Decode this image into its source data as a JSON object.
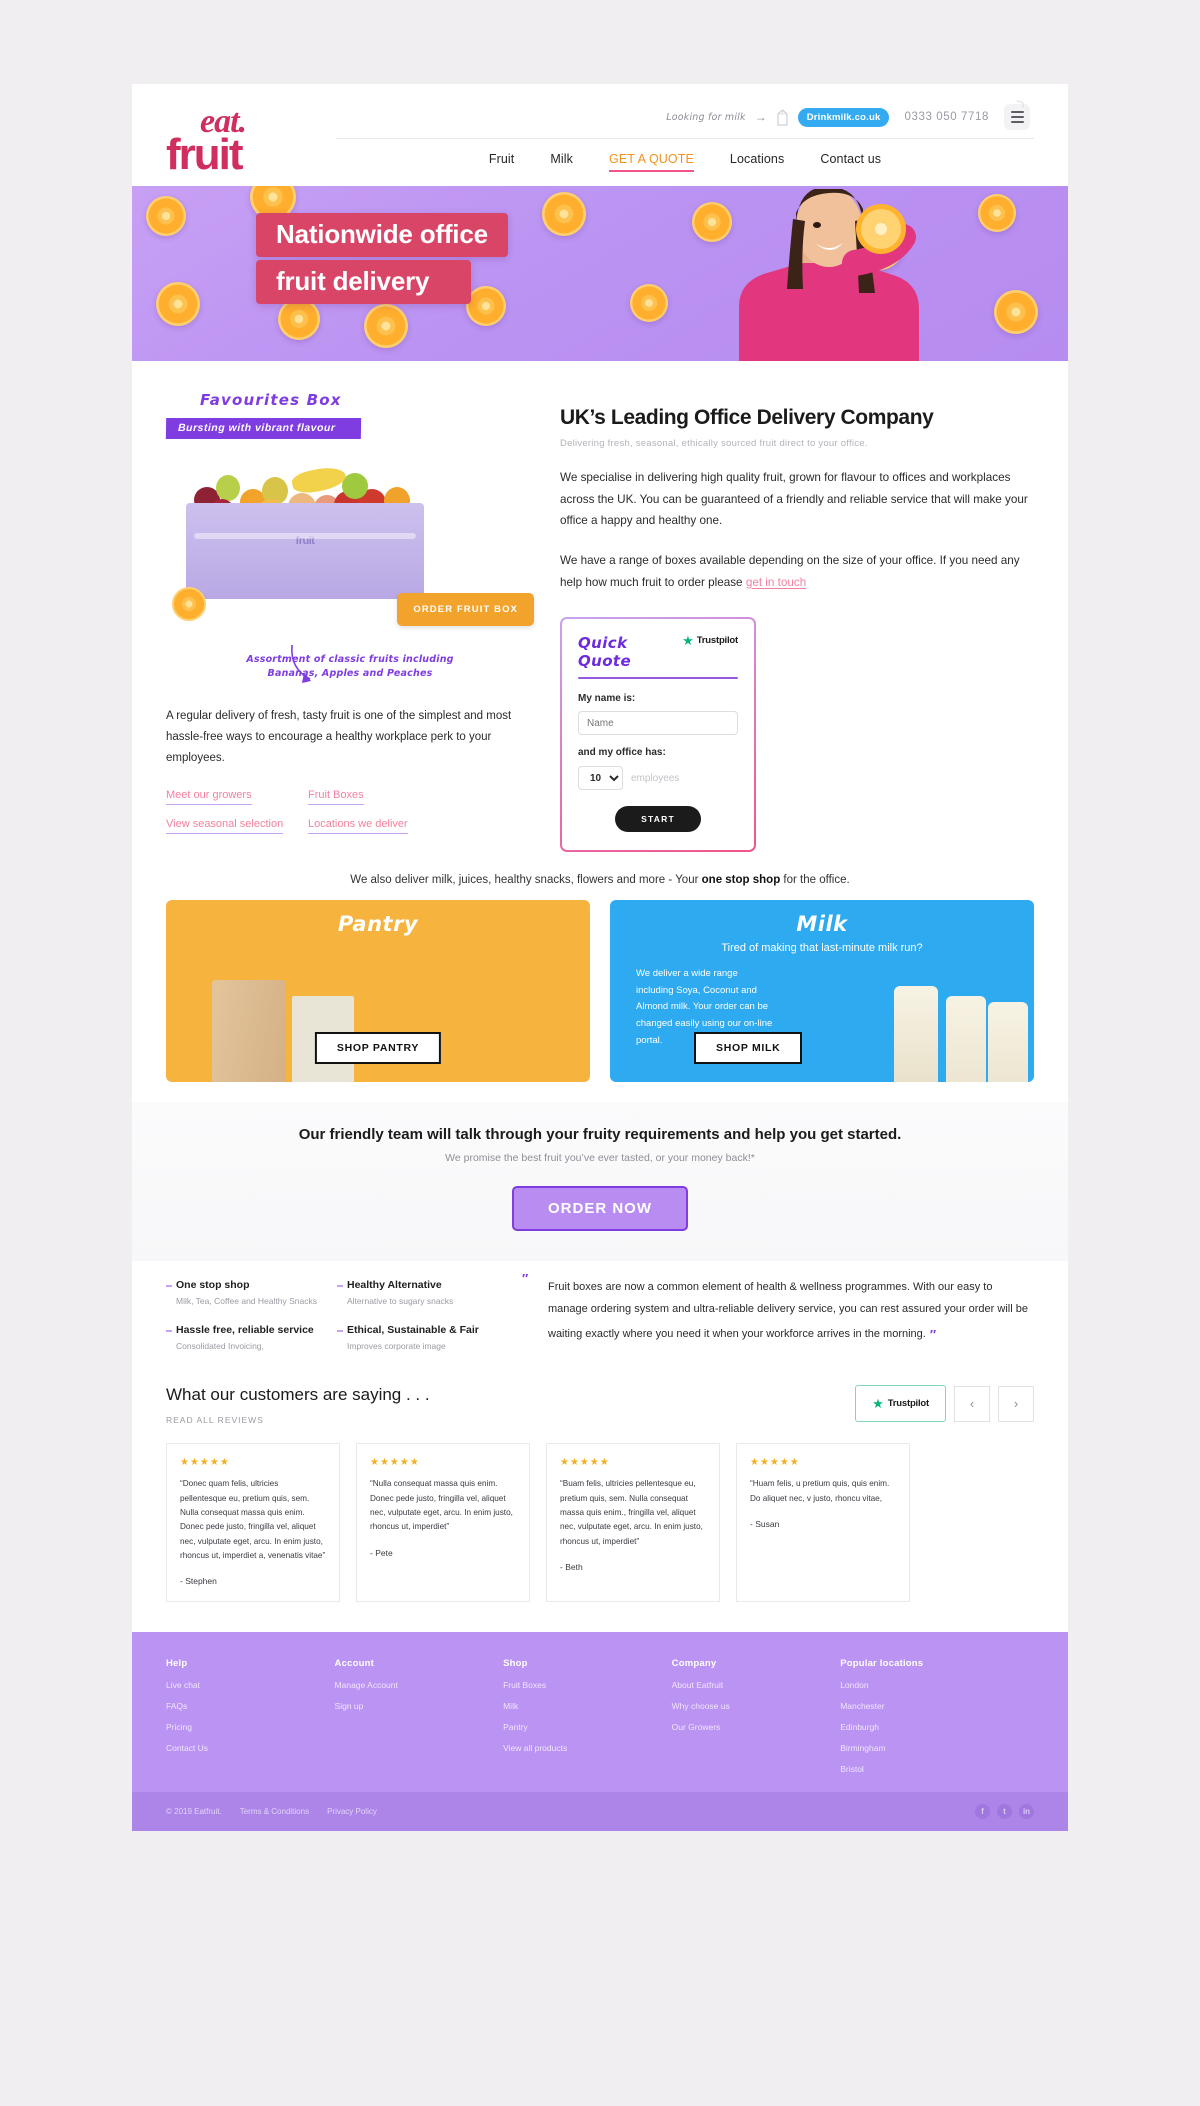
{
  "header": {
    "logo_top": "eat.",
    "logo_bottom": "fruit",
    "utility_text": "Looking for milk",
    "arrow": "→",
    "milk_badge": "Drinkmilk.co.uk",
    "phone": "0333 050 7718",
    "nav": [
      {
        "label": "Fruit",
        "active": false
      },
      {
        "label": "Milk",
        "active": false
      },
      {
        "label": "GET A QUOTE",
        "active": true
      },
      {
        "label": "Locations",
        "active": false
      },
      {
        "label": "Contact us",
        "active": false
      }
    ]
  },
  "hero": {
    "line1": "Nationwide office",
    "line2": "fruit delivery"
  },
  "box": {
    "title": "Favourites  Box",
    "band": "Bursting with vibrant flavour",
    "crate_label": "fruit",
    "order_button": "ORDER FRUIT BOX",
    "assortment_line1": "Assortment of classic fruits including",
    "assortment_line2": "Bananas, Apples and Peaches"
  },
  "intro": {
    "heading": "UK’s Leading Office Delivery Company",
    "subheading": "Delivering fresh, seasonal, ethically sourced fruit direct to your office.",
    "para1": "We specialise in delivering high quality fruit, grown for flavour to offices and workplaces across the UK.  You can be guaranteed of a friendly and reliable service that will make your office a happy and healthy one.",
    "para2_before": "We have a range of boxes available depending on the size of your office. If you need any help how much fruit to order please ",
    "para2_link": "get in touch"
  },
  "left_blurb": "A regular delivery of fresh, tasty fruit is one of the simplest and most hassle-free ways to encourage a healthy workplace perk to your employees.",
  "links": [
    "Meet our growers",
    "Fruit Boxes",
    "View seasonal selection",
    "Locations we deliver"
  ],
  "quote_form": {
    "title": "Quick Quote",
    "trustpilot": "Trustpilot",
    "name_label": "My name is:",
    "name_placeholder": "Name",
    "office_label": "and my office has:",
    "employee_count": "10",
    "employees_label": "employees",
    "start_button": "START"
  },
  "onestop": {
    "before": "We also deliver milk, juices, healthy snacks, flowers and more  - Your ",
    "bold": "one stop shop",
    "after": " for the office."
  },
  "cards": {
    "pantry": {
      "title": "Pantry",
      "button": "SHOP PANTRY"
    },
    "milk": {
      "title": "Milk",
      "subtitle": "Tired of making that last-minute milk run?",
      "copy": "We deliver a wide range including Soya, Coconut and Almond milk. Your order can be changed easily using our on-line portal.",
      "button": "SHOP MILK"
    }
  },
  "cta": {
    "heading": "Our friendly team will talk through your fruity requirements and help you get started.",
    "sub": "We promise the best fruit you’ve ever tasted, or your money back!*",
    "button": "ORDER NOW"
  },
  "features": [
    {
      "title": "One stop shop",
      "desc": "Milk, Tea, Coffee and Healthy Snacks"
    },
    {
      "title": "Healthy Alternative",
      "desc": "Alternative to sugary snacks"
    },
    {
      "title": "Hassle free, reliable service",
      "desc": "Consolidated Invoicing,"
    },
    {
      "title": "Ethical, Sustainable & Fair",
      "desc": "Improves corporate image"
    }
  ],
  "testimonial": {
    "open_mark": "″",
    "text": "Fruit boxes are now a common element of health & wellness programmes. With our easy to manage ordering system and ultra-reliable delivery service, you can rest assured your order will be waiting exactly where you need it when your workforce arrives in the morning.",
    "close_mark": "″"
  },
  "reviews": {
    "title": "What our customers are saying . . .",
    "read_all": "READ ALL REVIEWS",
    "trustpilot": "Trustpilot",
    "prev": "‹",
    "next": "›",
    "items": [
      {
        "stars": "★★★★★",
        "text": "“Donec quam felis, ultricies pellentesque eu, pretium quis, sem. Nulla consequat massa quis enim. Donec pede justo, fringilla vel, aliquet nec, vulputate eget, arcu. In enim justo, rhoncus ut, imperdiet a, venenatis vitae”",
        "name": "- Stephen"
      },
      {
        "stars": "★★★★★",
        "text": "“Nulla consequat massa quis enim. Donec pede justo, fringilla vel, aliquet nec, vulputate eget, arcu. In enim justo, rhoncus ut, imperdiet”",
        "name": "- Pete"
      },
      {
        "stars": "★★★★★",
        "text": "“Buam felis, ultricies pellentesque eu, pretium quis, sem. Nulla consequat massa quis enim., fringilla vel, aliquet nec, vulputate eget, arcu. In enim justo, rhoncus ut, imperdiet”",
        "name": "- Beth"
      },
      {
        "stars": "★★★★★",
        "text": "“Huam felis, u pretium quis, quis enim. Do aliquet nec, v justo, rhoncu vitae,",
        "name": "- Susan"
      }
    ]
  },
  "footer": {
    "columns": [
      {
        "heading": "Help",
        "links": [
          "Live chat",
          "FAQs",
          "Pricing",
          "Contact Us"
        ]
      },
      {
        "heading": "Account",
        "links": [
          "Manage Account",
          "Sign up"
        ]
      },
      {
        "heading": "Shop",
        "links": [
          "Fruit Boxes",
          "Milk",
          "Pantry",
          "View all products"
        ]
      },
      {
        "heading": "Company",
        "links": [
          "About Eatfruit",
          "Why choose us",
          "Our Growers"
        ]
      },
      {
        "heading": "Popular locations",
        "links": [
          "London",
          "Manchester",
          "Edinburgh",
          "Birmingham",
          "Bristol"
        ]
      }
    ],
    "copyright": "© 2019 Eatfruit.",
    "terms": "Terms & Conditions",
    "privacy": "Privacy Policy",
    "socials": [
      "f",
      "t",
      "in"
    ]
  },
  "colors": {
    "brand_pink": "#cf2e5f",
    "purple": "#7f3ce0",
    "hero_purple": "#bb93f2",
    "orange": "#f0921f",
    "blue": "#2eaaf0",
    "yellow": "#f6b43e"
  }
}
